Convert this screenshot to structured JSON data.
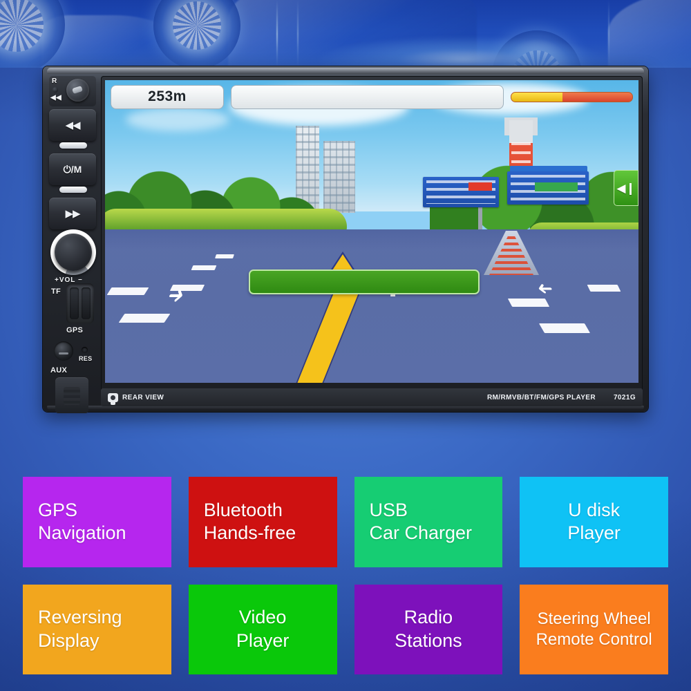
{
  "banner": {
    "name": "car-photo-banner"
  },
  "device": {
    "model": "7021G",
    "format_line": "RM/RMVB/BT/FM/GPS PLAYER",
    "rear_view_label": "REAR VIEW",
    "controls": {
      "reset_mark": "R",
      "rewind_mark": "◀◀",
      "prev_button": "◀◀",
      "power_mode_button": "⏻/M",
      "next_button": "▶▶",
      "volume_label": "+VOL −",
      "tf_label": "TF",
      "gps_label": "GPS",
      "res_label": "RES",
      "aux_label": "AUX"
    },
    "screen": {
      "distance": "253m",
      "road_name": "",
      "status_bar_text": "",
      "side_tab_glyph": "◀❙",
      "progress_percent": 42
    }
  },
  "features": [
    {
      "label_line1": "GPS",
      "label_line2": "Navigation",
      "color": "#b626ee",
      "align": "left"
    },
    {
      "label_line1": "Bluetooth",
      "label_line2": "Hands-free",
      "color": "#ce1111",
      "align": "left"
    },
    {
      "label_line1": "USB",
      "label_line2": "Car Charger",
      "color": "#16cd73",
      "align": "left"
    },
    {
      "label_line1": "U disk",
      "label_line2": "Player",
      "color": "#0fc2f5",
      "align": "center"
    },
    {
      "label_line1": "Reversing",
      "label_line2": "Display",
      "color": "#f2a61e",
      "align": "left"
    },
    {
      "label_line1": "Video",
      "label_line2": "Player",
      "color": "#0ac80a",
      "align": "center"
    },
    {
      "label_line1": "Radio",
      "label_line2": "Stations",
      "color": "#7d11bb",
      "align": "center"
    },
    {
      "label_line1": "Steering Wheel",
      "label_line2": "Remote Control",
      "color": "#fa7d1e",
      "align": "center"
    }
  ]
}
